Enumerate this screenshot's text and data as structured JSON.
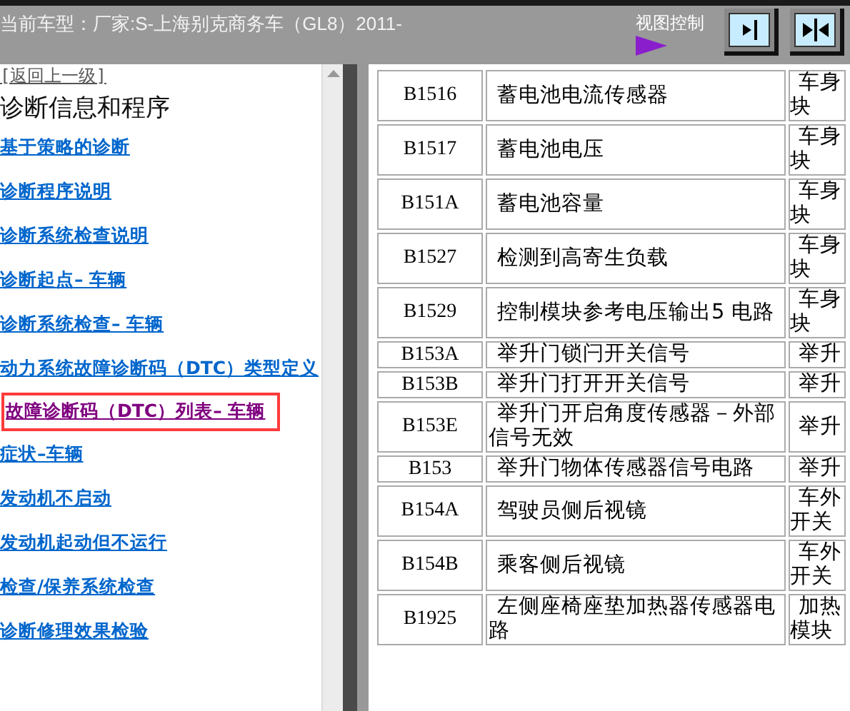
{
  "header": {
    "title": "当前车型：厂家:S-上海别克商务车（GL8）2011-",
    "view_control": "视图控制"
  },
  "sidebar": {
    "back_link": "[返回上一级]",
    "heading": "诊断信息和程序",
    "links": [
      {
        "label": "基于策略的诊断",
        "selected": false
      },
      {
        "label": "诊断程序说明",
        "selected": false
      },
      {
        "label": "诊断系统检查说明",
        "selected": false
      },
      {
        "label": "诊断起点– 车辆",
        "selected": false
      },
      {
        "label": "诊断系统检查– 车辆",
        "selected": false
      },
      {
        "label": "动力系统故障诊断码（DTC）类型定义",
        "selected": false
      },
      {
        "label": "故障诊断码（DTC）列表– 车辆",
        "selected": true
      },
      {
        "label": "症状–车辆",
        "selected": false
      },
      {
        "label": "发动机不启动",
        "selected": false
      },
      {
        "label": "发动机起动但不运行",
        "selected": false
      },
      {
        "label": "检查/保养系统检查",
        "selected": false
      },
      {
        "label": "诊断修理效果检验",
        "selected": false
      }
    ]
  },
  "table": {
    "rows": [
      {
        "code": "B1516",
        "description": "蓄电池电流传感器",
        "column_3": "车身块"
      },
      {
        "code": "B1517",
        "description": "蓄电池电压",
        "column_3": "车身块"
      },
      {
        "code": "B151A",
        "description": "蓄电池容量",
        "column_3": "车身块"
      },
      {
        "code": "B1527",
        "description": "检测到高寄生负载",
        "column_3": "车身块"
      },
      {
        "code": "B1529",
        "description": "控制模块参考电压输出5 电路",
        "column_3": "车身块"
      },
      {
        "code": "B153A",
        "description": "举升门锁闩开关信号",
        "column_3": "举升"
      },
      {
        "code": "B153B",
        "description": "举升门打开开关信号",
        "column_3": "举升"
      },
      {
        "code": "B153E",
        "description": "举升门开启角度传感器－外部信号无效",
        "column_3": "举升"
      },
      {
        "code": "B153",
        "description": "举升门物体传感器信号电路",
        "column_3": "举升"
      },
      {
        "code": "B154A",
        "description": "驾驶员侧后视镜",
        "column_3": "车外开关"
      },
      {
        "code": "B154B",
        "description": "乘客侧后视镜",
        "column_3": "车外开关"
      },
      {
        "code": "B1925",
        "description": "左侧座椅座垫加热器传感器电路",
        "column_3": "加热模块"
      }
    ]
  }
}
